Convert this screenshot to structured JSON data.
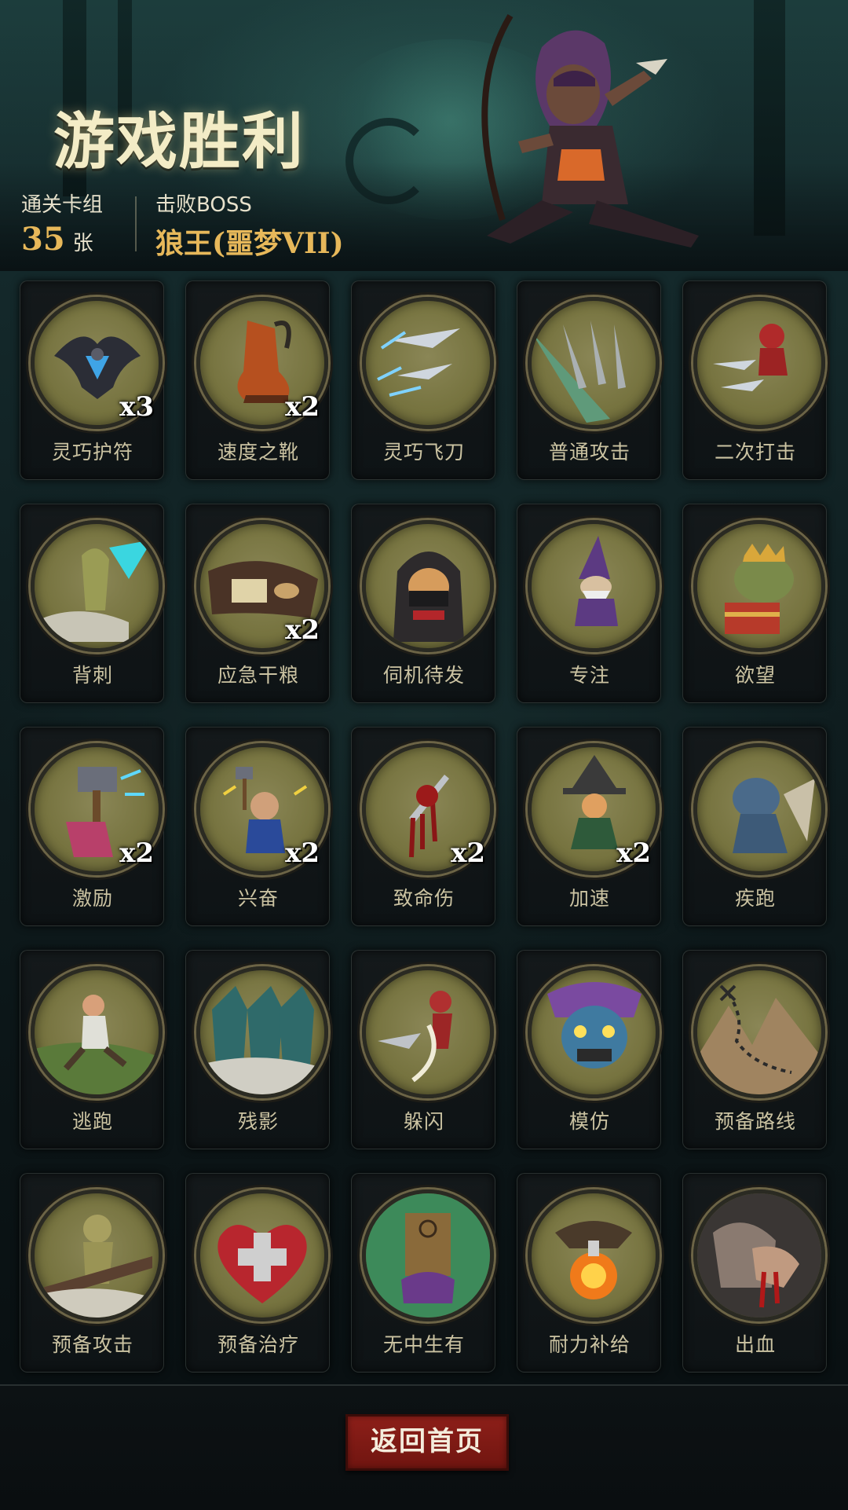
{
  "header": {
    "title": "游戏胜利",
    "deck_label": "通关卡组",
    "deck_count": "35",
    "deck_unit": "张",
    "boss_label": "击败BOSS",
    "boss_name": "狼王(噩梦VII)"
  },
  "cards": [
    {
      "name": "灵巧护符",
      "count": "x3",
      "icon": "charm-icon"
    },
    {
      "name": "速度之靴",
      "count": "x2",
      "icon": "boot-icon"
    },
    {
      "name": "灵巧飞刀",
      "count": "",
      "icon": "flying-knife-icon"
    },
    {
      "name": "普通攻击",
      "count": "",
      "icon": "daggers-icon"
    },
    {
      "name": "二次打击",
      "count": "",
      "icon": "double-strike-icon"
    },
    {
      "name": "背刺",
      "count": "",
      "icon": "backstab-icon"
    },
    {
      "name": "应急干粮",
      "count": "x2",
      "icon": "rations-icon"
    },
    {
      "name": "伺机待发",
      "count": "",
      "icon": "hooded-ninja-icon"
    },
    {
      "name": "专注",
      "count": "",
      "icon": "wizard-icon"
    },
    {
      "name": "欲望",
      "count": "",
      "icon": "toad-king-icon"
    },
    {
      "name": "激励",
      "count": "x2",
      "icon": "hammer-icon"
    },
    {
      "name": "兴奋",
      "count": "x2",
      "icon": "dwarf-icon"
    },
    {
      "name": "致命伤",
      "count": "x2",
      "icon": "bleeding-blade-icon"
    },
    {
      "name": "加速",
      "count": "x2",
      "icon": "witch-icon"
    },
    {
      "name": "疾跑",
      "count": "",
      "icon": "running-beast-icon"
    },
    {
      "name": "逃跑",
      "count": "",
      "icon": "fleeing-man-icon"
    },
    {
      "name": "残影",
      "count": "",
      "icon": "afterimage-icon"
    },
    {
      "name": "躲闪",
      "count": "",
      "icon": "dodge-icon"
    },
    {
      "name": "模仿",
      "count": "",
      "icon": "goblin-mask-icon"
    },
    {
      "name": "预备路线",
      "count": "",
      "icon": "map-route-icon"
    },
    {
      "name": "预备攻击",
      "count": "",
      "icon": "puppet-icon"
    },
    {
      "name": "预备治疗",
      "count": "",
      "icon": "heart-cross-icon"
    },
    {
      "name": "无中生有",
      "count": "",
      "icon": "totem-icon"
    },
    {
      "name": "耐力补给",
      "count": "",
      "icon": "potion-bird-icon"
    },
    {
      "name": "出血",
      "count": "",
      "icon": "bleeding-hand-icon"
    }
  ],
  "footer": {
    "home_button": "返回首页"
  },
  "colors": {
    "gold": "#e7b85a",
    "medal": "#8a8656",
    "button_red": "#8d1f19"
  }
}
